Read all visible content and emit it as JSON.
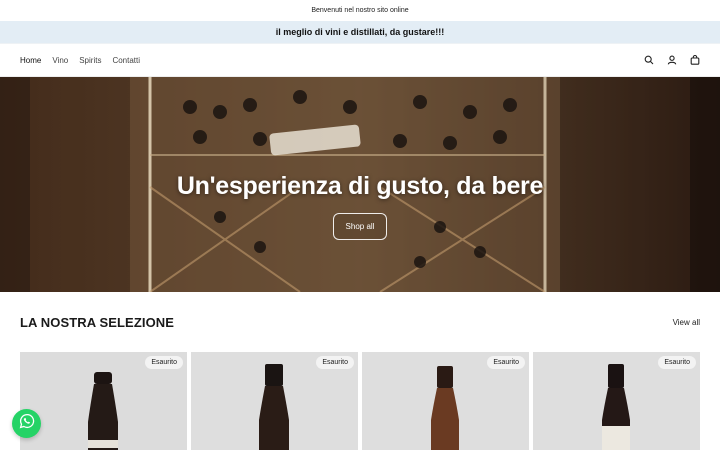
{
  "announcement": {
    "text": "Benvenuti nel nostro sito online"
  },
  "promo": {
    "text": "il meglio di vini e distillati, da gustare!!!"
  },
  "nav": {
    "items": [
      {
        "label": "Home"
      },
      {
        "label": "Vino"
      },
      {
        "label": "Spirits"
      },
      {
        "label": "Contatti"
      }
    ]
  },
  "header_icons": [
    "search-icon",
    "account-icon",
    "cart-icon"
  ],
  "hero": {
    "title": "Un'esperienza di gusto, da bere",
    "button_label": "Shop all"
  },
  "selection": {
    "title": "LA NOSTRA SELEZIONE",
    "view_all_label": "View all",
    "products": [
      {
        "badge": "Esaurito"
      },
      {
        "badge": "Esaurito"
      },
      {
        "badge": "Esaurito"
      },
      {
        "badge": "Esaurito"
      }
    ]
  },
  "colors": {
    "promo_bg": "#e3edf5",
    "whatsapp": "#25d366",
    "text": "#1a1a1a"
  }
}
